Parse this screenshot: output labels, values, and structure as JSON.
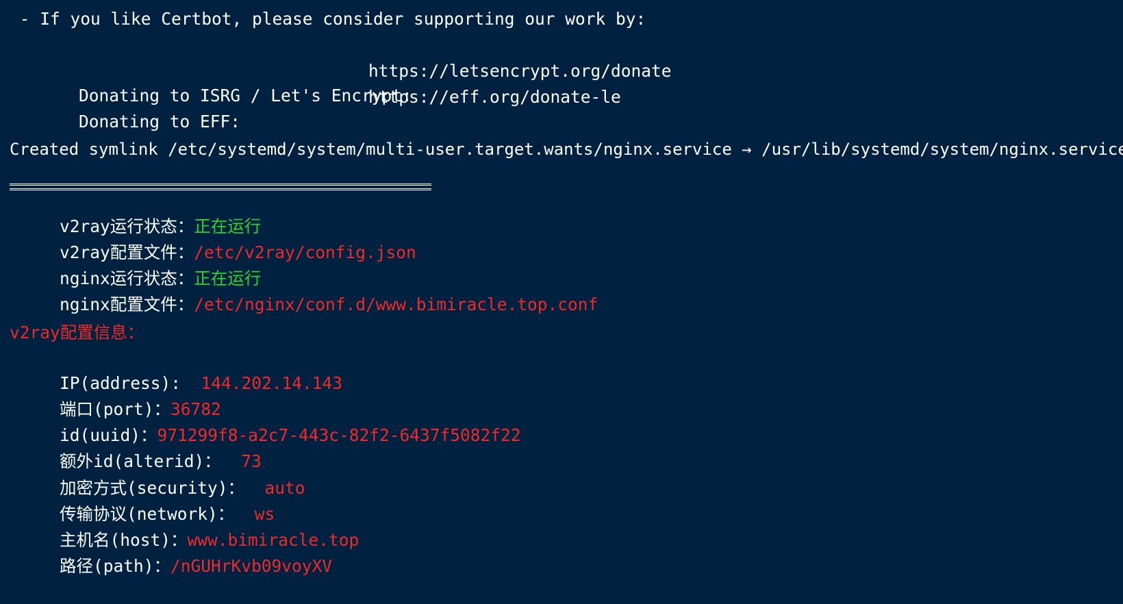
{
  "certbot": {
    "support_line": " - If you like Certbot, please consider supporting our work by:",
    "donate_isrg_label": "Donating to ISRG / Let's Encrypt:",
    "donate_isrg_url": "https://letsencrypt.org/donate",
    "donate_eff_label": "Donating to EFF:",
    "donate_eff_url": "https://eff.org/donate-le"
  },
  "symlink_line": "Created symlink /etc/systemd/system/multi-user.target.wants/nginx.service → /usr/lib/systemd/system/nginx.service.",
  "status": {
    "v2ray_state_label": "v2ray运行状态：",
    "v2ray_state_value": "正在运行",
    "v2ray_config_label": "v2ray配置文件：",
    "v2ray_config_value": "/etc/v2ray/config.json",
    "nginx_state_label": "nginx运行状态：",
    "nginx_state_value": "正在运行",
    "nginx_config_label": "nginx配置文件：",
    "nginx_config_value": "/etc/nginx/conf.d/www.bimiracle.top.conf"
  },
  "config_info": {
    "heading": "v2ray配置信息：",
    "ip_label": "IP(address):",
    "ip_value": "144.202.14.143",
    "port_label": "端口(port)：",
    "port_value": "36782",
    "uuid_label": "id(uuid)：",
    "uuid_value": "971299f8-a2c7-443c-82f2-6437f5082f22",
    "alterid_label": "额外id(alterid)：",
    "alterid_value": "73",
    "security_label": "加密方式(security)：",
    "security_value": "auto",
    "network_label": "传输协议(network)：",
    "network_value": "ws",
    "host_label": "主机名(host)：",
    "host_value": "www.bimiracle.top",
    "path_label": "路径(path)：",
    "path_value": "/nGUHrKvb09voyXV"
  },
  "colors": {
    "background": "#002240",
    "text": "#ffffff",
    "running": "#2ed22e",
    "value": "#f02a2a"
  }
}
